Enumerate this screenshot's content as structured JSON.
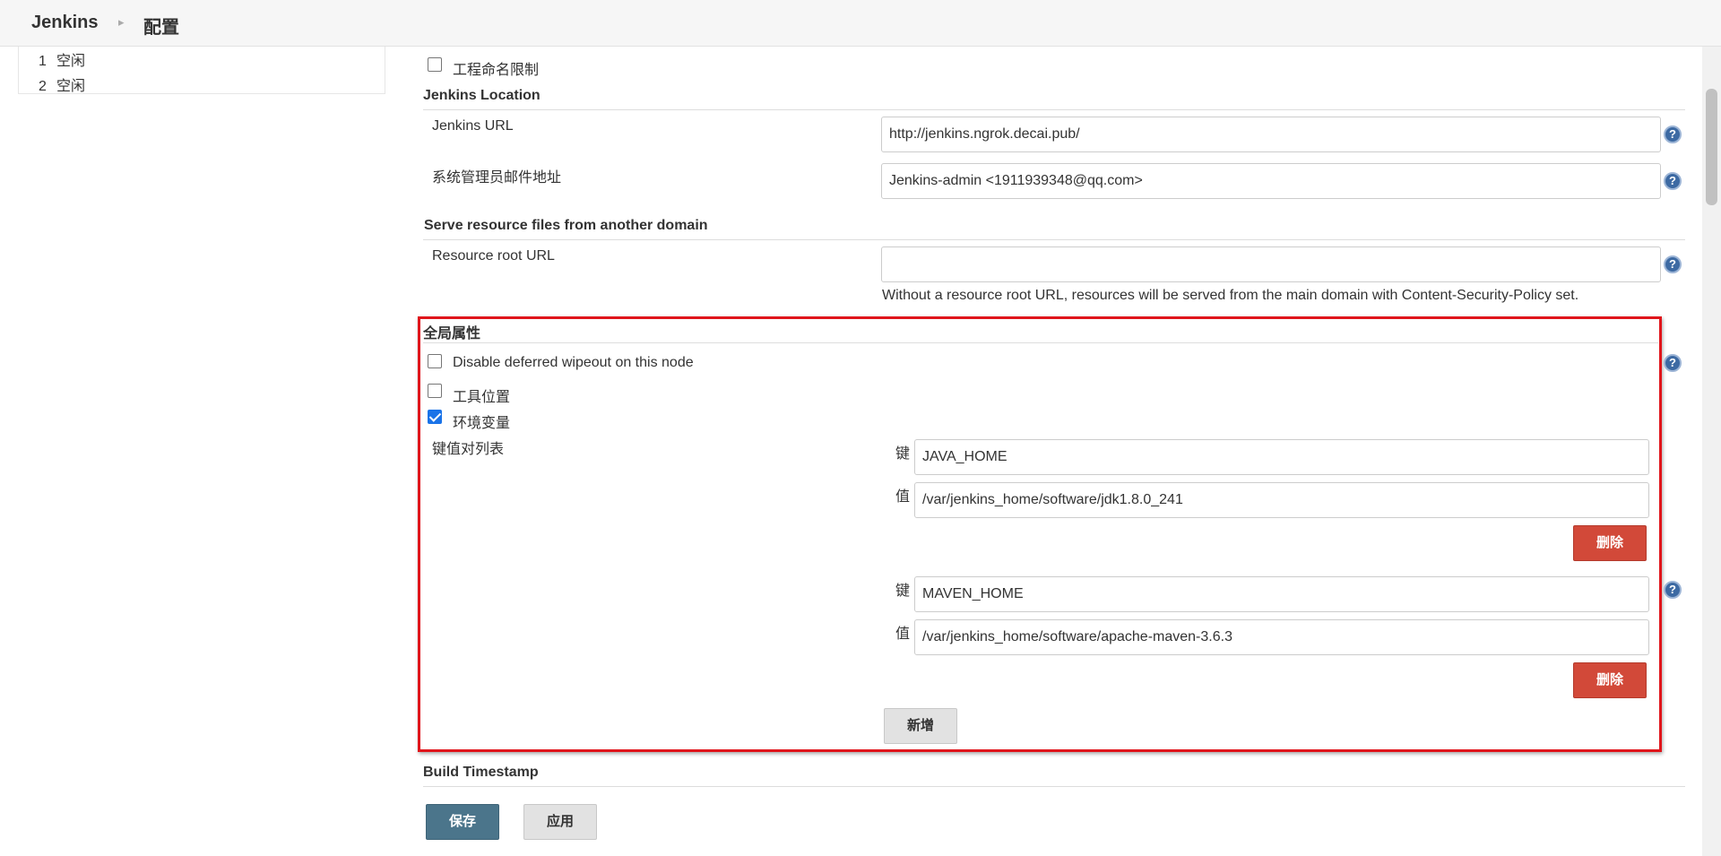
{
  "breadcrumb": {
    "home": "Jenkins",
    "separator": "▸",
    "page": "配置"
  },
  "executors": [
    {
      "num": "1",
      "status": "空闲"
    },
    {
      "num": "2",
      "status": "空闲"
    }
  ],
  "project_naming": {
    "label": "工程命名限制",
    "checked": false
  },
  "jenkins_location": {
    "title": "Jenkins Location",
    "url_label": "Jenkins URL",
    "url_value": "http://jenkins.ngrok.decai.pub/",
    "email_label": "系统管理员邮件地址",
    "email_value": "Jenkins-admin <1911939348@qq.com>"
  },
  "resource_domain": {
    "title": "Serve resource files from another domain",
    "label": "Resource root URL",
    "value": "",
    "hint": "Without a resource root URL, resources will be served from the main domain with Content-Security-Policy set."
  },
  "global_properties": {
    "title": "全局属性",
    "disable_wipeout": {
      "label": "Disable deferred wipeout on this node",
      "checked": false
    },
    "tool_locations": {
      "label": "工具位置",
      "checked": false
    },
    "env_vars": {
      "label": "环境变量",
      "checked": true
    },
    "kv_label": "键值对列表",
    "key_label": "键",
    "value_label": "值",
    "entries": [
      {
        "key": "JAVA_HOME",
        "value": "/var/jenkins_home/software/jdk1.8.0_241",
        "delete": "删除"
      },
      {
        "key": "MAVEN_HOME",
        "value": "/var/jenkins_home/software/apache-maven-3.6.3",
        "delete": "删除"
      }
    ],
    "add": "新增"
  },
  "build_timestamp": {
    "title": "Build Timestamp"
  },
  "footer": {
    "save": "保存",
    "apply": "应用"
  },
  "help_icon_glyph": "?",
  "colors": {
    "delete": "#d24939",
    "save": "#4b758b",
    "highlight": "#e0151b",
    "help": "#3d6aa3"
  }
}
